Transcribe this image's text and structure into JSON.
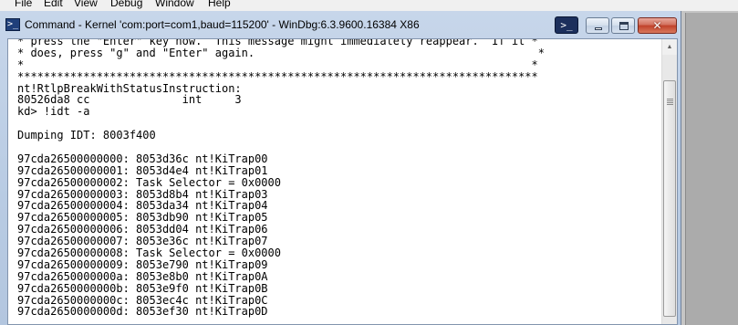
{
  "menu": {
    "items": [
      "File",
      "Edit",
      "View",
      "Debug",
      "Window",
      "Help"
    ]
  },
  "window": {
    "title": "Command - Kernel 'com:port=com1,baud=115200' - WinDbg:6.3.9600.16384 X86",
    "app_icon": "command-prompt-icon",
    "cmd_button_glyph": ">_",
    "close_glyph": "✕"
  },
  "console": {
    "lines": [
      "* press the \"Enter\" key now.  This message might immediately reappear.  If it *",
      "* does, press \"g\" and \"Enter\" again.                                           *",
      "*                                                                             *",
      "*******************************************************************************",
      "nt!RtlpBreakWithStatusInstruction:",
      "80526da8 cc              int     3",
      "kd> !idt -a",
      "",
      "Dumping IDT: 8003f400",
      "",
      "97cda26500000000: 8053d36c nt!KiTrap00",
      "97cda26500000001: 8053d4e4 nt!KiTrap01",
      "97cda26500000002: Task Selector = 0x0000",
      "97cda26500000003: 8053d8b4 nt!KiTrap03",
      "97cda26500000004: 8053da34 nt!KiTrap04",
      "97cda26500000005: 8053db90 nt!KiTrap05",
      "97cda26500000006: 8053dd04 nt!KiTrap06",
      "97cda26500000007: 8053e36c nt!KiTrap07",
      "97cda26500000008: Task Selector = 0x0000",
      "97cda26500000009: 8053e790 nt!KiTrap09",
      "97cda2650000000a: 8053e8b0 nt!KiTrap0A",
      "97cda2650000000b: 8053e9f0 nt!KiTrap0B",
      "97cda2650000000c: 8053ec4c nt!KiTrap0C",
      "97cda2650000000d: 8053ef30 nt!KiTrap0D"
    ]
  }
}
